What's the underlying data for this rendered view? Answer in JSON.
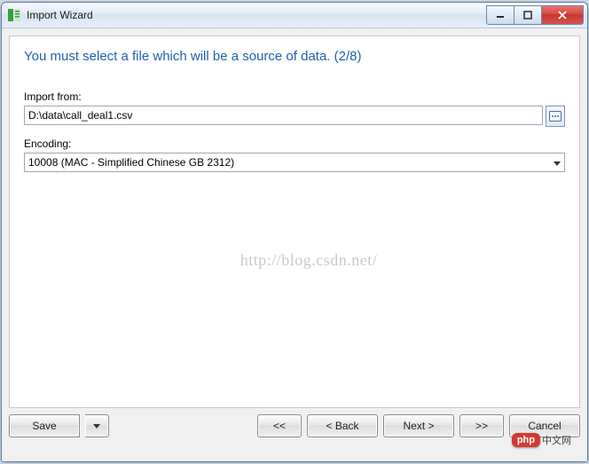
{
  "window": {
    "title": "Import Wizard"
  },
  "wizard": {
    "heading": "You must select a file which will be a source of data. (2/8)",
    "import_from_label": "Import from:",
    "import_from_value": "D:\\data\\call_deal1.csv",
    "encoding_label": "Encoding:",
    "encoding_value": "10008 (MAC - Simplified Chinese GB 2312)",
    "watermark": "http://blog.csdn.net/"
  },
  "buttons": {
    "save": "Save",
    "first": "<<",
    "back": "< Back",
    "next": "Next >",
    "last": ">>",
    "cancel": "Cancel"
  },
  "overlay": {
    "brand": "php",
    "site": "中文网"
  }
}
